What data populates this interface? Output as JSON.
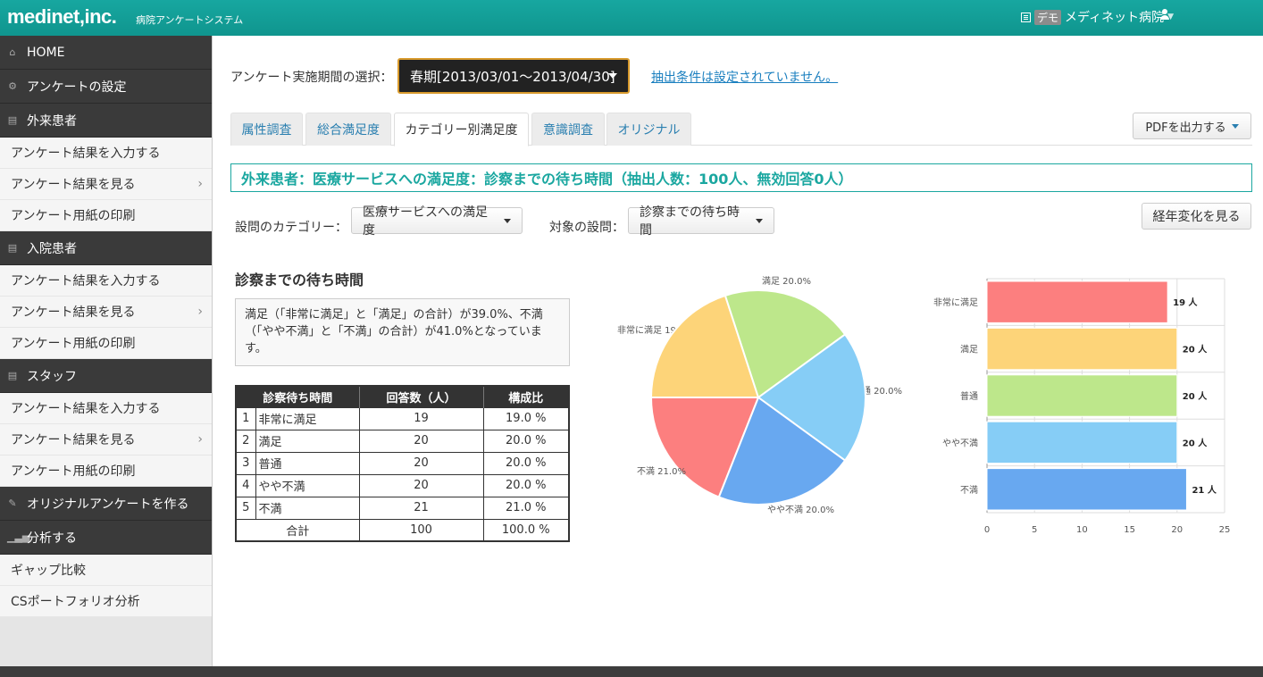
{
  "header": {
    "logo": "medinet,inc.",
    "subtitle": "病院アンケートシステム",
    "demo_badge": "デモ",
    "hospital": "メディネット病院"
  },
  "sidebar": {
    "home": "HOME",
    "settings": "アンケートの設定",
    "outpatient": {
      "title": "外来患者",
      "items": [
        "アンケート結果を入力する",
        "アンケート結果を見る",
        "アンケート用紙の印刷"
      ]
    },
    "inpatient": {
      "title": "入院患者",
      "items": [
        "アンケート結果を入力する",
        "アンケート結果を見る",
        "アンケート用紙の印刷"
      ]
    },
    "staff": {
      "title": "スタッフ",
      "items": [
        "アンケート結果を入力する",
        "アンケート結果を見る",
        "アンケート用紙の印刷"
      ]
    },
    "original": "オリジナルアンケートを作る",
    "analysis": {
      "title": "分析する",
      "items": [
        "ギャップ比較",
        "CSポートフォリオ分析"
      ]
    }
  },
  "toolbar": {
    "period_label": "アンケート実施期間の選択：",
    "period_value": "春期[2013/03/01～2013/04/30]",
    "filter_link": "抽出条件は設定されていません。",
    "pdf_button": "PDFを出力する"
  },
  "tabs": [
    "属性調査",
    "総合満足度",
    "カテゴリー別満足度",
    "意識調査",
    "オリジナル"
  ],
  "active_tab": 2,
  "title_bar": "外来患者：医療サービスへの満足度：診察までの待ち時間（抽出人数：100人、無効回答0人）",
  "selectors": {
    "category_label": "設問のカテゴリー：",
    "category_value": "医療サービスへの満足度",
    "question_label": "対象の設問：",
    "question_value": "診察までの待ち時間",
    "trend_button": "経年変化を見る"
  },
  "section_title": "診察までの待ち時間",
  "summary": "満足（「非常に満足」と「満足」の合計）が39.0%、不満（「やや不満」と「不満」の合計）が41.0%となっています。",
  "table": {
    "headers": [
      "診察待ち時間",
      "回答数（人）",
      "構成比"
    ],
    "rows": [
      {
        "no": "1",
        "name": "非常に満足",
        "count": "19",
        "ratio": "19.0 %"
      },
      {
        "no": "2",
        "name": "満足",
        "count": "20",
        "ratio": "20.0 %"
      },
      {
        "no": "3",
        "name": "普通",
        "count": "20",
        "ratio": "20.0 %"
      },
      {
        "no": "4",
        "name": "やや不満",
        "count": "20",
        "ratio": "20.0 %"
      },
      {
        "no": "5",
        "name": "不満",
        "count": "21",
        "ratio": "21.0 %"
      }
    ],
    "total": {
      "label": "合計",
      "count": "100",
      "ratio": "100.0 %"
    }
  },
  "chart_data": [
    {
      "type": "pie",
      "labels": [
        "非常に満足",
        "満足",
        "普通",
        "やや不満",
        "不満"
      ],
      "values": [
        19.0,
        20.0,
        20.0,
        20.0,
        21.0
      ],
      "display_labels": [
        "非常に満足 19.0%",
        "満足 20.0%",
        "普通 20.0%",
        "やや不満 20.0%",
        "不満 21.0%"
      ],
      "colors": [
        "#fc7f7f",
        "#fdd479",
        "#bde78b",
        "#86cdf6",
        "#68a8f0"
      ]
    },
    {
      "type": "bar",
      "orientation": "horizontal",
      "categories": [
        "非常に満足",
        "満足",
        "普通",
        "やや不満",
        "不満"
      ],
      "values": [
        19,
        20,
        20,
        20,
        21
      ],
      "value_labels": [
        "19 人",
        "20 人",
        "20 人",
        "20 人",
        "21 人"
      ],
      "xlim": [
        0,
        25
      ],
      "xticks": [
        0,
        5,
        10,
        15,
        20,
        25
      ],
      "colors": [
        "#fc7f7f",
        "#fdd479",
        "#bde78b",
        "#86cdf6",
        "#68a8f0"
      ],
      "grid": true
    }
  ]
}
